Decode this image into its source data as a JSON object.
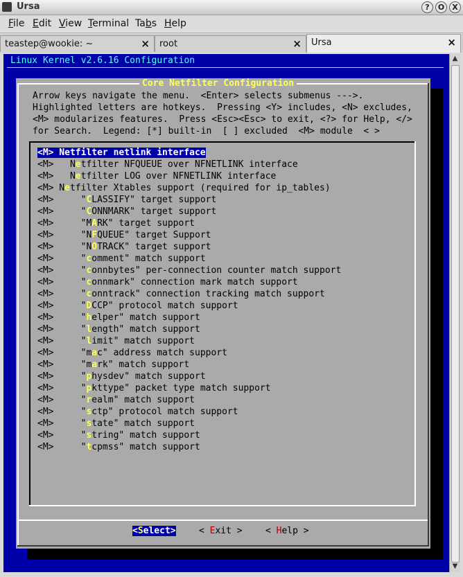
{
  "window": {
    "title": "Ursa",
    "buttons": [
      "?",
      "O",
      "X"
    ]
  },
  "menu": {
    "items": [
      {
        "hk": "F",
        "rest": "ile"
      },
      {
        "hk": "E",
        "rest": "dit"
      },
      {
        "hk": "V",
        "rest": "iew"
      },
      {
        "hk": "T",
        "rest": "erminal"
      },
      {
        "pre": "Ta",
        "hk": "b",
        "rest": "s"
      },
      {
        "hk": "H",
        "rest": "elp"
      }
    ]
  },
  "tabs": [
    {
      "label": "teastep@wookie: ~",
      "close": "×"
    },
    {
      "label": "root",
      "close": "×"
    },
    {
      "label": "Ursa",
      "close": "×"
    }
  ],
  "terminal": {
    "header": "Linux Kernel v2.6.16 Configuration",
    "dialog_title": "Core Netfilter Configuration",
    "help_lines": [
      "Arrow keys navigate the menu.  <Enter> selects submenus --->.",
      "Highlighted letters are hotkeys.  Pressing <Y> includes, <N> excludes,",
      "<M> modularizes features.  Press <Esc><Esc> to exit, <?> for Help, </>",
      "for Search.  Legend: [*] built-in  [ ] excluded  <M> module  < >"
    ],
    "items": [
      {
        "pre": "<",
        "hk": "M",
        "post": "> Netfilter netlink interface",
        "selected": true
      },
      {
        "pre": "<M>   N",
        "hk": "e",
        "post": "tfilter NFQUEUE over NFNETLINK interface"
      },
      {
        "pre": "<M>   N",
        "hk": "e",
        "post": "tfilter LOG over NFNETLINK interface"
      },
      {
        "pre": "<M> N",
        "hk": "e",
        "post": "tfilter Xtables support (required for ip_tables)"
      },
      {
        "pre": "<M>     \"",
        "hk": "C",
        "post": "LASSIFY\" target support"
      },
      {
        "pre": "<M>     \"",
        "hk": "C",
        "post": "ONNMARK\" target support"
      },
      {
        "pre": "<M>     \"M",
        "hk": "A",
        "post": "RK\" target support"
      },
      {
        "pre": "<M>     \"N",
        "hk": "F",
        "post": "QUEUE\" target Support"
      },
      {
        "pre": "<M>     \"N",
        "hk": "O",
        "post": "TRACK\" target support"
      },
      {
        "pre": "<M>     \"",
        "hk": "c",
        "post": "omment\" match support"
      },
      {
        "pre": "<M>     \"",
        "hk": "c",
        "post": "onnbytes\" per-connection counter match support"
      },
      {
        "pre": "<M>     \"",
        "hk": "c",
        "post": "onnmark\" connection mark match support"
      },
      {
        "pre": "<M>     \"",
        "hk": "c",
        "post": "onntrack\" connection tracking match support"
      },
      {
        "pre": "<M>     \"",
        "hk": "D",
        "post": "CCP\" protocol match support"
      },
      {
        "pre": "<M>     \"",
        "hk": "h",
        "post": "elper\" match support"
      },
      {
        "pre": "<M>     \"",
        "hk": "l",
        "post": "ength\" match support"
      },
      {
        "pre": "<M>     \"",
        "hk": "l",
        "post": "imit\" match support"
      },
      {
        "pre": "<M>     \"m",
        "hk": "a",
        "post": "c\" address match support"
      },
      {
        "pre": "<M>     \"m",
        "hk": "a",
        "post": "rk\" match support"
      },
      {
        "pre": "<M>     \"",
        "hk": "p",
        "post": "hysdev\" match support"
      },
      {
        "pre": "<M>     \"",
        "hk": "p",
        "post": "kttype\" packet type match support"
      },
      {
        "pre": "<M>     \"",
        "hk": "r",
        "post": "ealm\" match support"
      },
      {
        "pre": "<M>     \"",
        "hk": "s",
        "post": "ctp\" protocol match support"
      },
      {
        "pre": "<M>     \"",
        "hk": "s",
        "post": "tate\" match support"
      },
      {
        "pre": "<M>     \"",
        "hk": "s",
        "post": "tring\" match support"
      },
      {
        "pre": "<M>     \"",
        "hk": "t",
        "post": "cpmss\" match support"
      }
    ],
    "buttons": {
      "select": {
        "pre": "<",
        "hk": "S",
        "post": "elect>"
      },
      "exit": {
        "pre": "< ",
        "hk": "E",
        "post": "xit >"
      },
      "help": {
        "pre": "< ",
        "hk": "H",
        "post": "elp >"
      }
    }
  }
}
